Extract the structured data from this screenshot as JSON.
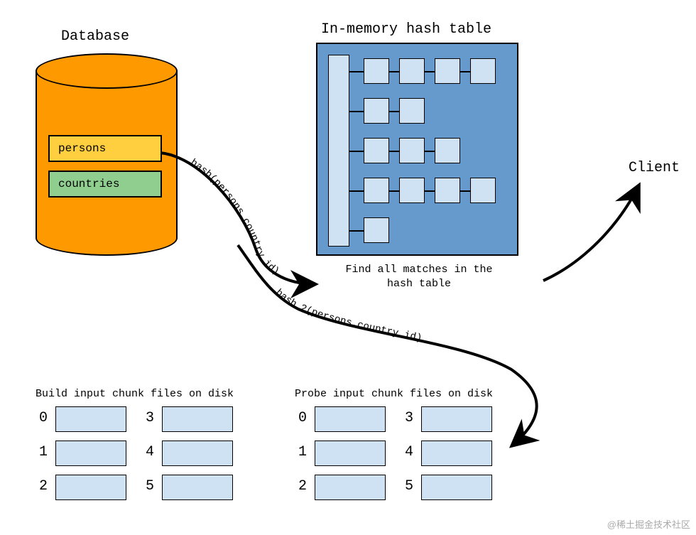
{
  "labels": {
    "database": "Database",
    "hashtable": "In-memory hash table",
    "client": "Client",
    "find_matches_l1": "Find all matches in the",
    "find_matches_l2": "hash table",
    "hash_fn": "hash(persons.country_id)",
    "hash2_fn": "hash_2(persons.country_id)",
    "build_chunks": "Build input chunk files on disk",
    "probe_chunks": "Probe input chunk files on disk"
  },
  "db_tables": {
    "persons": "persons",
    "countries": "countries"
  },
  "hash_rows": [
    4,
    2,
    3,
    4,
    1
  ],
  "chunk_groups": {
    "build": {
      "indices": [
        "0",
        "1",
        "2",
        "3",
        "4",
        "5"
      ]
    },
    "probe": {
      "indices": [
        "0",
        "1",
        "2",
        "3",
        "4",
        "5"
      ]
    }
  },
  "watermark": "@稀土掘金技术社区"
}
